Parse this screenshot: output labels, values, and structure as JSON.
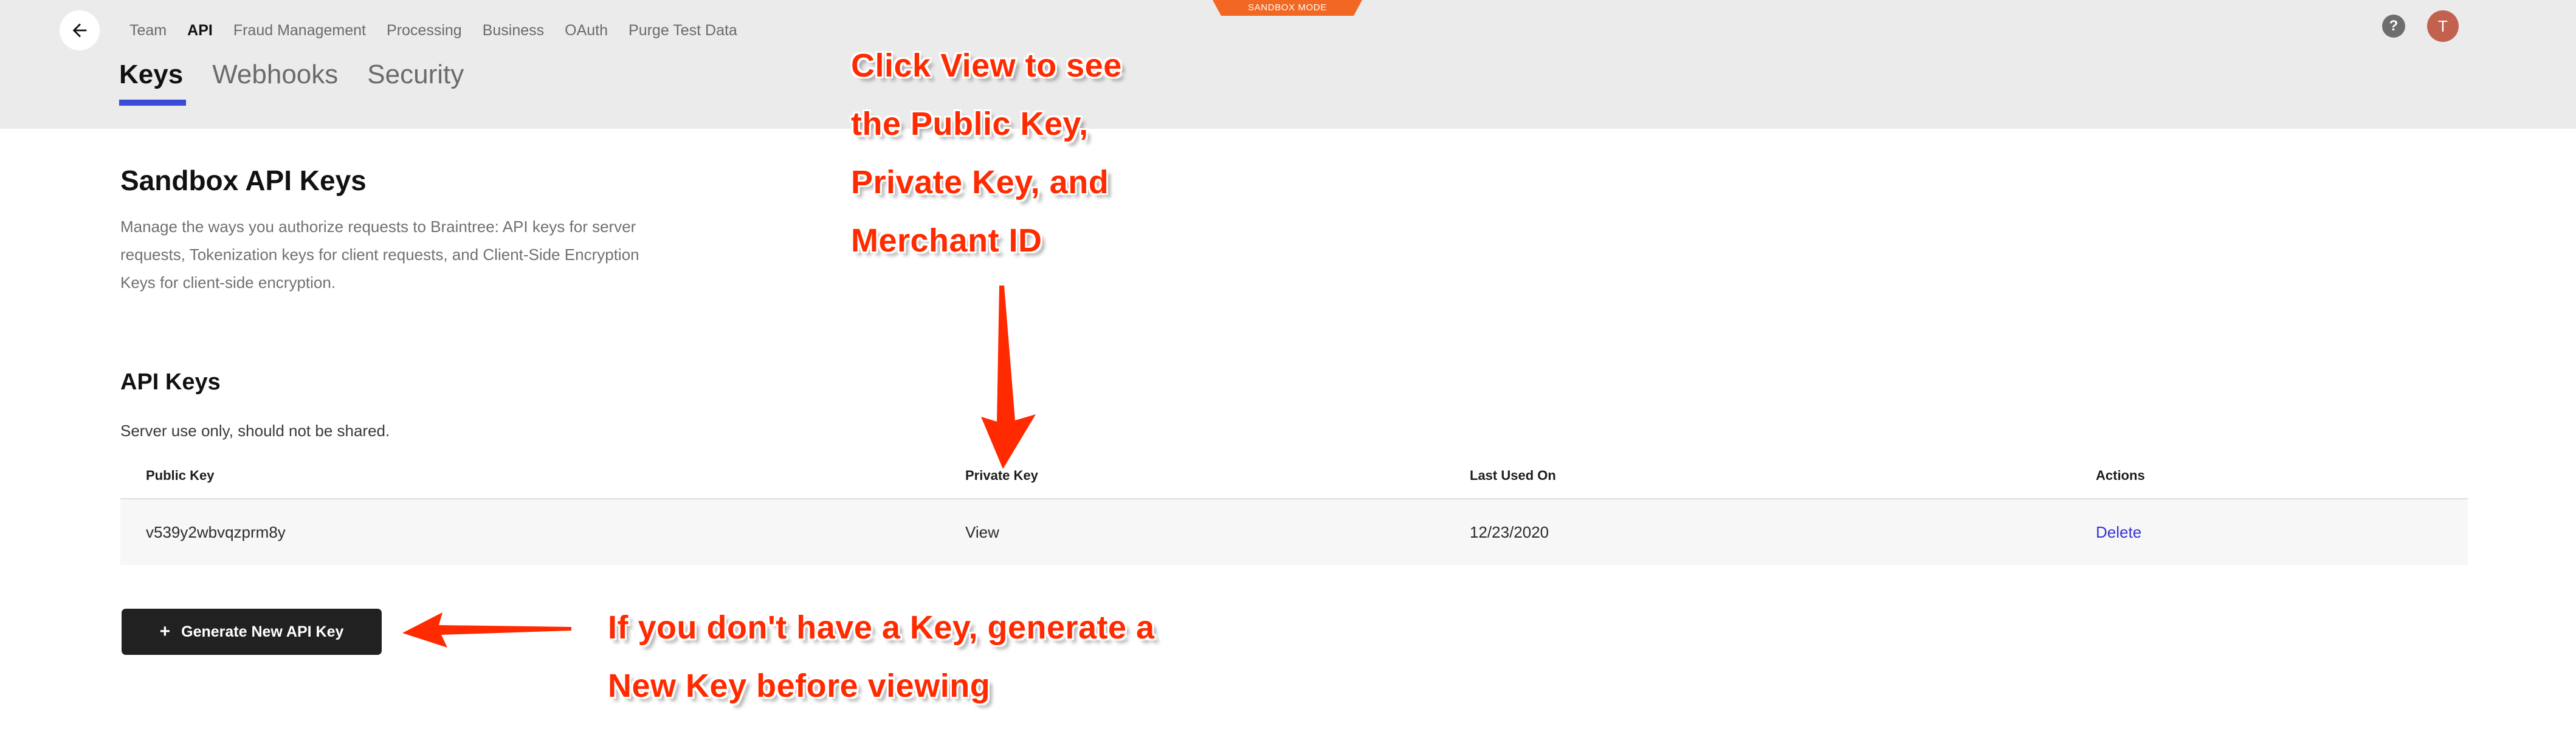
{
  "header": {
    "badge_label": "SANDBOX MODE",
    "badge_color": "#f26722",
    "back_icon": "arrow-left-icon",
    "help_icon": "question-mark-icon",
    "help_label": "?",
    "avatar_initial": "T",
    "avatar_color": "#c2614e",
    "nav": [
      {
        "label": "Team",
        "active": false
      },
      {
        "label": "API",
        "active": true
      },
      {
        "label": "Fraud Management",
        "active": false
      },
      {
        "label": "Processing",
        "active": false
      },
      {
        "label": "Business",
        "active": false
      },
      {
        "label": "OAuth",
        "active": false
      },
      {
        "label": "Purge Test Data",
        "active": false
      }
    ]
  },
  "subtabs": [
    {
      "label": "Keys",
      "active": true
    },
    {
      "label": "Webhooks",
      "active": false
    },
    {
      "label": "Security",
      "active": false
    }
  ],
  "main": {
    "page_title": "Sandbox API Keys",
    "page_desc": "Manage the ways you authorize requests to Braintree: API keys for server requests, Tokenization keys for client requests, and Client-Side Encryption Keys for client-side encryption.",
    "section_title": "API Keys",
    "section_sub": "Server use only, should not be shared.",
    "table": {
      "columns": [
        "Public Key",
        "Private Key",
        "Last Used On",
        "Actions"
      ],
      "rows": [
        {
          "public_key": "v539y2wbvqzprm8y",
          "private_key_action": "View",
          "last_used_on": "12/23/2020",
          "action": "Delete"
        }
      ]
    },
    "generate_button": {
      "label": "Generate New API Key",
      "plus_icon": "plus-icon",
      "plus": "+"
    }
  },
  "annotations": {
    "accent_color": "#ff2a00",
    "top_text": "Click View to see\nthe Public Key,\nPrivate Key, and\nMerchant ID",
    "bottom_text": "If you don't have a Key, generate a\nNew Key before viewing",
    "down_arrow_icon": "arrow-down-icon",
    "left_arrow_icon": "arrow-left-icon"
  }
}
